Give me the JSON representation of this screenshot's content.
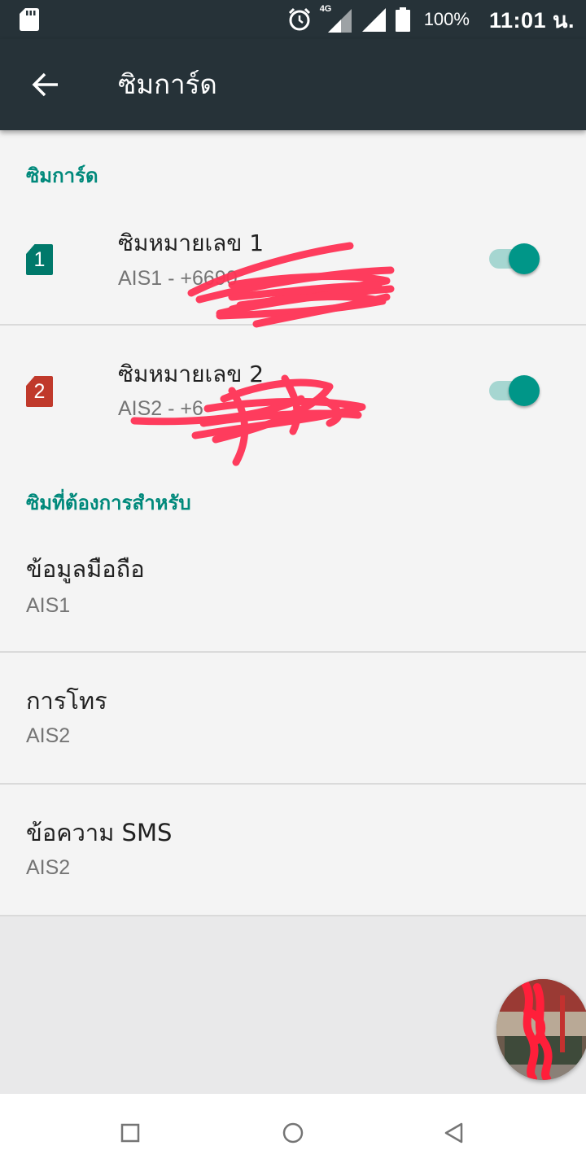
{
  "status_bar": {
    "sd_icon": "sd-card-icon",
    "alarm_icon": "alarm-icon",
    "network_type": "4G",
    "battery_percent": "100%",
    "time": "11:01 น."
  },
  "app_bar": {
    "back_icon": "arrow-back-icon",
    "title": "ซิมการ์ด"
  },
  "sim_section": {
    "header": "ซิมการ์ด",
    "sims": [
      {
        "badge": "1",
        "badge_color": "#00796b",
        "title": "ซิมหมายเลข 1",
        "subtitle": "AIS1 - +6690",
        "enabled": true
      },
      {
        "badge": "2",
        "badge_color": "#c0392b",
        "title": "ซิมหมายเลข 2",
        "subtitle": "AIS2 - +6",
        "enabled": true
      }
    ]
  },
  "preferred_section": {
    "header": "ซิมที่ต้องการสำหรับ",
    "items": [
      {
        "title": "ข้อมูลมือถือ",
        "value": "AIS1"
      },
      {
        "title": "การโทร",
        "value": "AIS2"
      },
      {
        "title": "ข้อความ SMS",
        "value": "AIS2"
      }
    ]
  },
  "nav_bar": {
    "recents_icon": "square-recents-icon",
    "home_icon": "circle-home-icon",
    "back_icon": "triangle-back-icon"
  },
  "colors": {
    "toolbar": "#263238",
    "accent": "#009688",
    "section_header": "#00897b",
    "redaction": "#ff3355"
  }
}
